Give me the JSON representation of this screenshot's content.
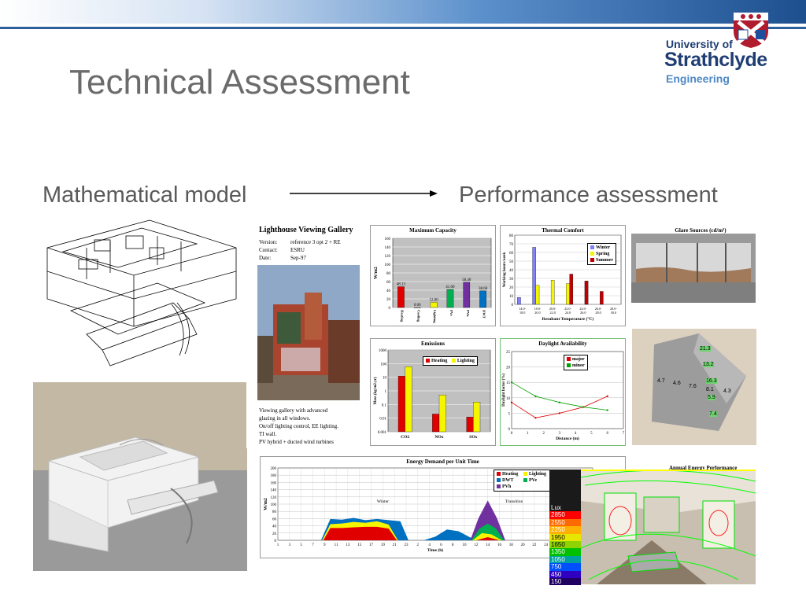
{
  "slide": {
    "title": "Technical Assessment",
    "left_heading": "Mathematical model",
    "right_heading": "Performance assessment"
  },
  "logo": {
    "line1": "University of",
    "line2": "Strathclyde",
    "line3": "Engineering"
  },
  "gallery": {
    "heading": "Lighthouse Viewing Gallery",
    "rows": [
      {
        "k": "Version:",
        "v": "reference 3 opt 2 + RE"
      },
      {
        "k": "Contact:",
        "v": "ESRU"
      },
      {
        "k": "Date:",
        "v": "Sep-97"
      }
    ],
    "notes": [
      "Viewing gallery with advanced",
      "glazing in all windows.",
      "On/off lighting control, EE lighting.",
      "TI wall.",
      "PV hybrid + ducted wind turbines"
    ]
  },
  "chart_data": [
    {
      "type": "bar",
      "title": "Maximum Capacity",
      "ylabel": "W/m2",
      "ylim": [
        0,
        160
      ],
      "yticks": [
        0,
        20,
        40,
        60,
        80,
        100,
        120,
        140,
        160
      ],
      "categories": [
        "Heating",
        "Cooling",
        "Lighting",
        "PVe",
        "PVh",
        "DWT"
      ],
      "values": [
        48.13,
        0.0,
        12.0,
        41.6,
        58.4,
        38.6
      ],
      "labels": [
        "48.13",
        "0.00",
        "12.00",
        "41.60",
        "58.40",
        "38.60"
      ],
      "colors": [
        "#e00000",
        "#7f7f7f",
        "#f5f500",
        "#00b050",
        "#7030a0",
        "#0070c0"
      ]
    },
    {
      "type": "bar",
      "title": "Thermal Comfort",
      "xlabel": "Resultant Temperature (°C)",
      "ylabel": "Working hours/week",
      "ylim": [
        0,
        80
      ],
      "yticks": [
        0,
        10,
        20,
        30,
        40,
        50,
        60,
        70,
        80
      ],
      "categories": [
        "14.0-18.0",
        "18.0-20.0",
        "20.0-22.0",
        "22.0-24.0",
        "24.0-26.0",
        "26.0-28.0",
        "28.0-30.0"
      ],
      "series": [
        {
          "name": "Winter",
          "color": "#7f7fff",
          "values": [
            8,
            66,
            0,
            0,
            0,
            0,
            0
          ]
        },
        {
          "name": "Spring",
          "color": "#f5f500",
          "values": [
            0,
            22,
            28,
            24,
            0,
            0,
            0
          ]
        },
        {
          "name": "Summer",
          "color": "#c00000",
          "values": [
            0,
            0,
            0,
            35,
            27,
            15,
            0
          ]
        }
      ]
    },
    {
      "type": "bar",
      "title": "Emissions",
      "ylabel": "Mass (kg/m2.yr)",
      "log_scale": true,
      "ylim": [
        0.001,
        1000
      ],
      "yticks": [
        "0.001",
        "0.01",
        "0.1",
        "1",
        "10",
        "100",
        "1000"
      ],
      "categories": [
        "CO2",
        "NOx",
        "SOx"
      ],
      "series": [
        {
          "name": "Heating",
          "color": "#e00000",
          "values": [
            12,
            0.02,
            0.012
          ]
        },
        {
          "name": "Lighting",
          "color": "#f5f500",
          "values": [
            60,
            0.5,
            0.15
          ]
        }
      ]
    },
    {
      "type": "line",
      "title": "Daylight Availability",
      "xlabel": "Distance (m)",
      "ylabel": "Daylight factor (%)",
      "xlim": [
        0,
        7
      ],
      "ylim": [
        0,
        25
      ],
      "xticks": [
        0,
        1,
        2,
        3,
        4,
        5,
        6,
        7
      ],
      "yticks": [
        0,
        5,
        10,
        15,
        20,
        25
      ],
      "series": [
        {
          "name": "major",
          "color": "#e00000",
          "x": [
            0,
            1.5,
            3,
            4.5,
            6
          ],
          "y": [
            8.5,
            3.5,
            5,
            7,
            10.5
          ]
        },
        {
          "name": "minor",
          "color": "#00a000",
          "x": [
            0,
            1.5,
            3,
            4.5,
            6
          ],
          "y": [
            15,
            10.5,
            8.5,
            7,
            6
          ]
        }
      ]
    },
    {
      "type": "area",
      "title": "Energy Demand per Unit Time",
      "xlabel": "Time (h)",
      "ylabel": "W/m2",
      "ylim": [
        0,
        200
      ],
      "yticks": [
        0,
        20,
        40,
        60,
        80,
        100,
        120,
        140,
        160,
        180,
        200
      ],
      "xticks": [
        "1",
        "3",
        "5",
        "7",
        "9",
        "11",
        "13",
        "15",
        "17",
        "19",
        "21",
        "23",
        "2",
        "4",
        "6",
        "8",
        "10",
        "12",
        "14",
        "16",
        "18",
        "20",
        "22",
        "24",
        "1",
        "3",
        "5",
        "7"
      ],
      "annotations": [
        "Winter",
        "Transition"
      ],
      "series": [
        {
          "name": "Heating",
          "color": "#e00000"
        },
        {
          "name": "Lighting",
          "color": "#f5f500"
        },
        {
          "name": "DWT",
          "color": "#0070c0"
        },
        {
          "name": "PVe",
          "color": "#00b050"
        },
        {
          "name": "PVh",
          "color": "#7030a0"
        }
      ],
      "winter_peak": 62,
      "transition_peak": 110
    }
  ],
  "images": {
    "glare_title": "Glare Sources (cd/m²)",
    "luminance_labels": [
      "21.3",
      "13.2",
      "16.3",
      "4.7",
      "4.6",
      "7.6",
      "7.4",
      "8.1",
      "4.3",
      "5.9"
    ],
    "annual_title": "Annual Energy Performance",
    "lux_scale": [
      "Lux",
      "2850",
      "2550",
      "2250",
      "1950",
      "1650",
      "1350",
      "1050",
      "750",
      "450",
      "150"
    ]
  }
}
